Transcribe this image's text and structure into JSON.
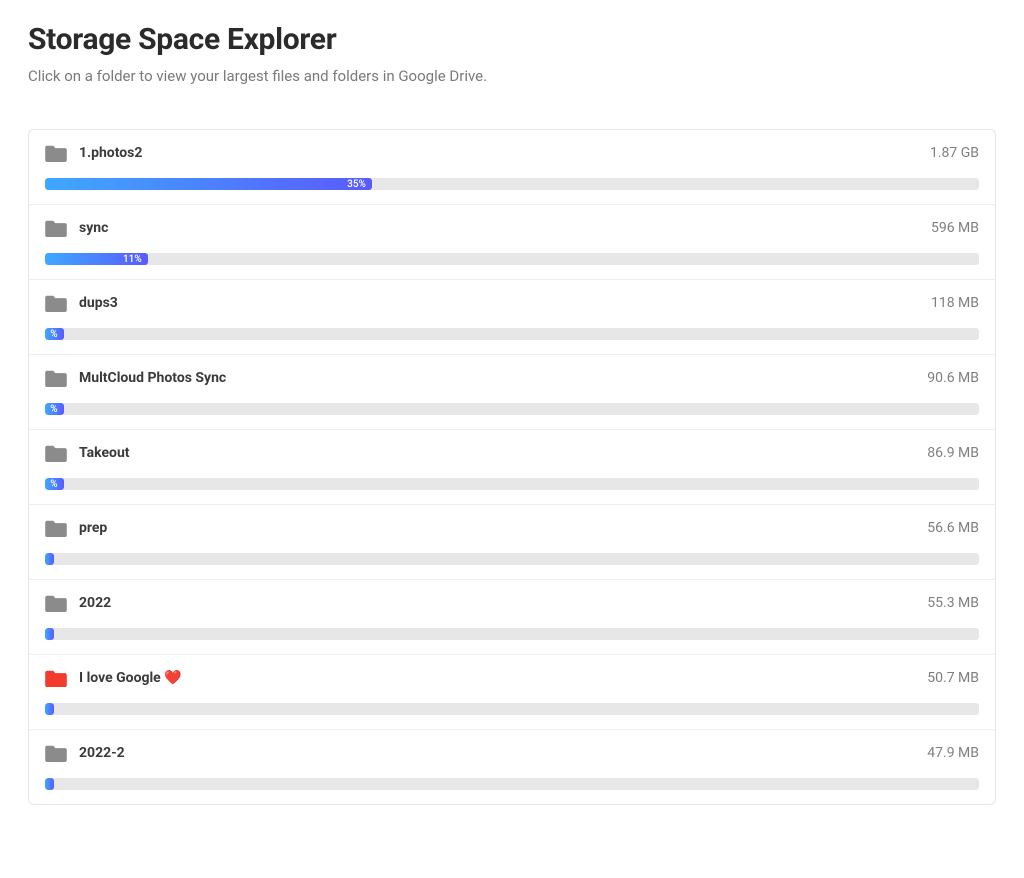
{
  "header": {
    "title": "Storage Space Explorer",
    "subtitle": "Click on a folder to view your largest files and folders in Google Drive."
  },
  "folders": [
    {
      "name": "1.photos2",
      "size": "1.87 GB",
      "percent": 35,
      "percent_label": "35%",
      "icon_color": "gray"
    },
    {
      "name": "sync",
      "size": "596 MB",
      "percent": 11,
      "percent_label": "11%",
      "icon_color": "gray"
    },
    {
      "name": "dups3",
      "size": "118 MB",
      "percent": 2,
      "percent_label": "%",
      "icon_color": "gray"
    },
    {
      "name": "MultCloud Photos Sync",
      "size": "90.6 MB",
      "percent": 2,
      "percent_label": "%",
      "icon_color": "gray"
    },
    {
      "name": "Takeout",
      "size": "86.9 MB",
      "percent": 2,
      "percent_label": "%",
      "icon_color": "gray"
    },
    {
      "name": "prep",
      "size": "56.6 MB",
      "percent": 1,
      "percent_label": "",
      "icon_color": "gray"
    },
    {
      "name": "2022",
      "size": "55.3 MB",
      "percent": 1,
      "percent_label": "",
      "icon_color": "gray"
    },
    {
      "name": "I love Google ❤️",
      "size": "50.7 MB",
      "percent": 1,
      "percent_label": "",
      "icon_color": "red"
    },
    {
      "name": "2022-2",
      "size": "47.9 MB",
      "percent": 1,
      "percent_label": "",
      "icon_color": "gray"
    }
  ]
}
